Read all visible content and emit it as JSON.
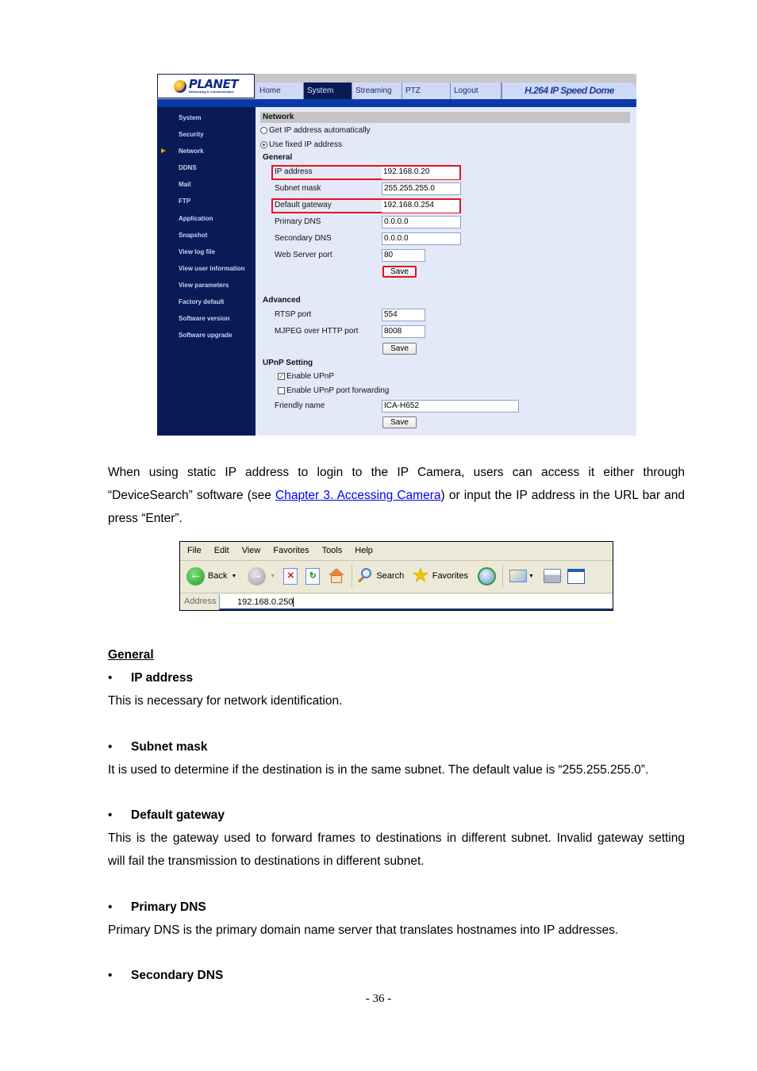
{
  "camera_ui": {
    "logo": {
      "brand": "PLANET",
      "tagline": "Networking & Communication"
    },
    "tabs": [
      {
        "label": "Home",
        "active": false
      },
      {
        "label": "System",
        "active": true
      },
      {
        "label": "Streaming",
        "active": false
      },
      {
        "label": "PTZ",
        "active": false
      },
      {
        "label": "Logout",
        "active": false
      }
    ],
    "product_title": "H.264 IP Speed Dome",
    "sidebar": {
      "items": [
        {
          "label": "System"
        },
        {
          "label": "Security"
        },
        {
          "label": "Network",
          "active": true
        },
        {
          "label": "DDNS"
        },
        {
          "label": "Mail"
        },
        {
          "label": "FTP"
        },
        {
          "label": "Application"
        },
        {
          "label": "Snapshot"
        },
        {
          "label": "View log file"
        },
        {
          "label": "View user information"
        },
        {
          "label": "View parameters"
        },
        {
          "label": "Factory default"
        },
        {
          "label": "Software version"
        },
        {
          "label": "Software upgrade"
        }
      ]
    },
    "section_title": "Network",
    "ip_mode": {
      "auto_label": "Get IP address automatically",
      "fixed_label": "Use fixed IP address",
      "selected": "fixed"
    },
    "general": {
      "title": "General",
      "fields": [
        {
          "label": "IP address",
          "value": "192.168.0.20",
          "highlighted": true
        },
        {
          "label": "Subnet mask",
          "value": "255.255.255.0",
          "highlighted": false
        },
        {
          "label": "Default gateway",
          "value": "192.168.0.254",
          "highlighted": true
        },
        {
          "label": "Primary DNS",
          "value": "0.0.0.0",
          "highlighted": false
        },
        {
          "label": "Secondary DNS",
          "value": "0.0.0.0",
          "highlighted": false
        },
        {
          "label": "Web Server port",
          "value": "80",
          "highlighted": false
        }
      ],
      "save_label": "Save"
    },
    "advanced": {
      "title": "Advanced",
      "fields": [
        {
          "label": "RTSP port",
          "value": "554"
        },
        {
          "label": "MJPEG over HTTP port",
          "value": "8008"
        }
      ],
      "save_label": "Save"
    },
    "upnp": {
      "title": "UPnP Setting",
      "enable_upnp": {
        "label": "Enable UPnP",
        "checked": true
      },
      "enable_port_forwarding": {
        "label": "Enable UPnP port forwarding",
        "checked": false
      },
      "friendly_name": {
        "label": "Friendly name",
        "value": "ICA-H652"
      },
      "save_label": "Save"
    },
    "colors": {
      "highlight": "#e0141e",
      "sidebar": "#0a1a55",
      "accent_bar": "#0a3aa8",
      "panel": "#e4e9f8"
    }
  },
  "intro": {
    "text_before_link": "When using static IP address to login to the IP Camera, users can access it either through “DeviceSearch” software (see ",
    "link_text": "Chapter 3. Accessing Camera",
    "text_after_link": ") or input the IP address in the URL bar and press “Enter”."
  },
  "browser": {
    "menu": [
      "File",
      "Edit",
      "View",
      "Favorites",
      "Tools",
      "Help"
    ],
    "toolbar": {
      "back_label": "Back",
      "search_label": "Search",
      "favorites_label": "Favorites"
    },
    "address_label": "Address",
    "address_value": "192.168.0.250"
  },
  "doc": {
    "heading": "General",
    "items": [
      {
        "title": "IP address",
        "body": [
          "This is necessary for network identification."
        ]
      },
      {
        "title": "Subnet mask",
        "body": [
          "It is used to determine if the destination is in the same subnet. The default value is “255.255.255.0”."
        ]
      },
      {
        "title": "Default gateway",
        "body": [
          "This is the gateway used to forward frames to destinations in different subnet. Invalid gateway setting",
          "will fail the transmission to destinations in different subnet."
        ]
      },
      {
        "title": "Primary DNS",
        "body": [
          "Primary DNS is the primary domain name server that translates hostnames into IP addresses."
        ]
      },
      {
        "title": "Secondary DNS",
        "body": []
      }
    ],
    "bullet_char": "•"
  },
  "page_number": "- 36 -"
}
